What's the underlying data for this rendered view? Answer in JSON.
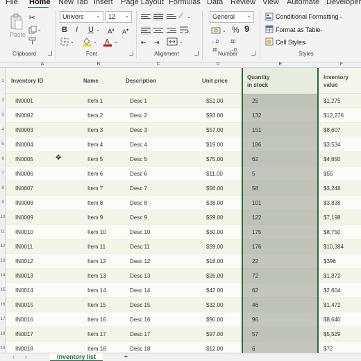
{
  "menu": {
    "tabs": [
      "File",
      "Home",
      "New Tab",
      "Insert",
      "Page Layout",
      "Formulas",
      "Data",
      "Review",
      "View",
      "Automate",
      "Developer"
    ]
  },
  "ribbon": {
    "groups": {
      "clipboard": "Clipboard",
      "font": "Font",
      "alignment": "Alignment",
      "number": "Number",
      "styles": "Styles"
    },
    "paste_label": "Paste",
    "font_name": "Univers",
    "font_size": "12",
    "bold": "B",
    "italic": "I",
    "underline": "U",
    "number_format": "General",
    "percent": "%",
    "comma": "9",
    "conditional_formatting": "Conditional Formatting",
    "format_as_table": "Format as Table",
    "cell_styles": "Cell Styles"
  },
  "grid": {
    "columns": [
      "A",
      "B",
      "C",
      "D",
      "E",
      "F"
    ],
    "rows": [
      "1",
      "2",
      "3",
      "4",
      "5",
      "6",
      "7",
      "8",
      "9",
      "10",
      "11",
      "12",
      "13",
      "14",
      "15",
      "16",
      "17",
      "18",
      "19",
      "20"
    ],
    "headers": {
      "id": "Inventory ID",
      "name": "Name",
      "desc": "Description",
      "price": "Unit price",
      "qty_line1": "Quantity",
      "qty_line2": "in stock",
      "value_line1": "Inventory",
      "value_line2": "value"
    },
    "data": [
      {
        "id": "IN0001",
        "name": "Item 1",
        "desc": "Desc 1",
        "price": "$51.00",
        "qty": "25",
        "value": "$1,275"
      },
      {
        "id": "IN0002",
        "name": "Item 2",
        "desc": "Desc 2",
        "price": "$93.00",
        "qty": "132",
        "value": "$12,276"
      },
      {
        "id": "IN0003",
        "name": "Item 3",
        "desc": "Desc 3",
        "price": "$57.00",
        "qty": "151",
        "value": "$8,607"
      },
      {
        "id": "IN0004",
        "name": "Item 4",
        "desc": "Desc 4",
        "price": "$19.00",
        "qty": "186",
        "value": "$3,534"
      },
      {
        "id": "IN0005",
        "name": "Item 5",
        "desc": "Desc 5",
        "price": "$75.00",
        "qty": "62",
        "value": "$4,650"
      },
      {
        "id": "IN0006",
        "name": "Item 6",
        "desc": "Desc 6",
        "price": "$11.00",
        "qty": "5",
        "value": "$55"
      },
      {
        "id": "IN0007",
        "name": "Item 7",
        "desc": "Desc 7",
        "price": "$56.00",
        "qty": "58",
        "value": "$3,248"
      },
      {
        "id": "IN0008",
        "name": "Item 8",
        "desc": "Desc 8",
        "price": "$38.00",
        "qty": "101",
        "value": "$3,838"
      },
      {
        "id": "IN0009",
        "name": "Item 9",
        "desc": "Desc 9",
        "price": "$59.00",
        "qty": "122",
        "value": "$7,198"
      },
      {
        "id": "IN0010",
        "name": "Item 10",
        "desc": "Desc 10",
        "price": "$50.00",
        "qty": "175",
        "value": "$8,750"
      },
      {
        "id": "IN0011",
        "name": "Item 11",
        "desc": "Desc 11",
        "price": "$59.00",
        "qty": "176",
        "value": "$10,384"
      },
      {
        "id": "IN0012",
        "name": "Item 12",
        "desc": "Desc 12",
        "price": "$18.00",
        "qty": "22",
        "value": "$396"
      },
      {
        "id": "IN0013",
        "name": "Item 13",
        "desc": "Desc 13",
        "price": "$26.00",
        "qty": "72",
        "value": "$1,872"
      },
      {
        "id": "IN0014",
        "name": "Item 14",
        "desc": "Desc 14",
        "price": "$42.00",
        "qty": "62",
        "value": "$2,604"
      },
      {
        "id": "IN0015",
        "name": "Item 15",
        "desc": "Desc 15",
        "price": "$32.00",
        "qty": "46",
        "value": "$1,472"
      },
      {
        "id": "IN0016",
        "name": "Item 16",
        "desc": "Desc 16",
        "price": "$90.00",
        "qty": "96",
        "value": "$8,640"
      },
      {
        "id": "IN0017",
        "name": "Item 17",
        "desc": "Desc 17",
        "price": "$97.00",
        "qty": "57",
        "value": "$5,529"
      },
      {
        "id": "IN0018",
        "name": "Item 18",
        "desc": "Desc 18",
        "price": "$12.00",
        "qty": "6",
        "value": "$72"
      }
    ]
  },
  "sheet_tabs": {
    "active": "Inventory list",
    "add": "+"
  },
  "colors": {
    "accent": "#1e6e3c"
  }
}
